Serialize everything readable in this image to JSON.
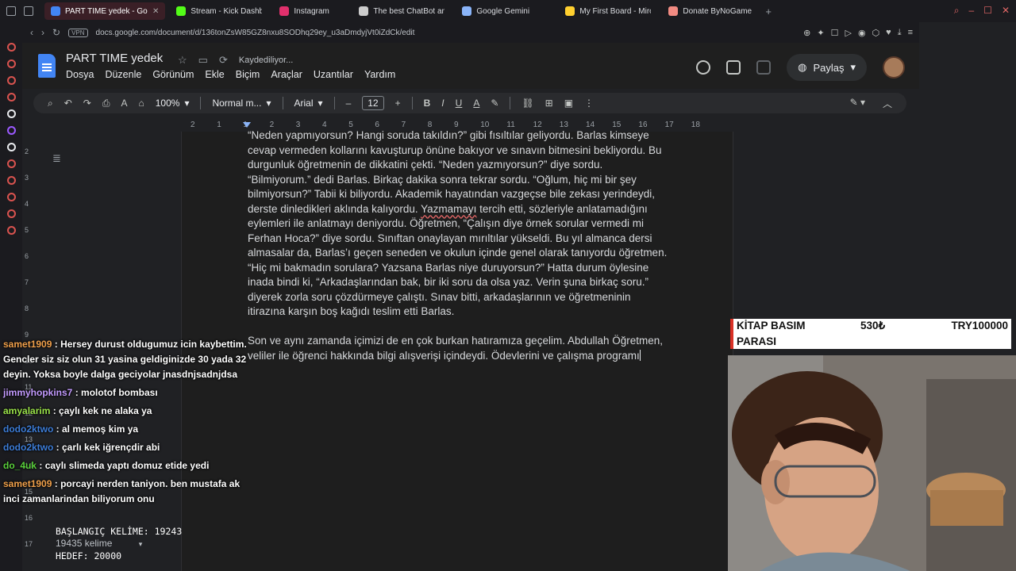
{
  "browser": {
    "tabs": [
      {
        "label": "PART TIME yedek - Goog",
        "color": "#4285f4",
        "active": true
      },
      {
        "label": "Stream - Kick Dashbo",
        "color": "#53fc18"
      },
      {
        "label": "Instagram",
        "color": "#e1306c"
      },
      {
        "label": "The best ChatBot and W",
        "color": "#cccccc"
      },
      {
        "label": "Google Gemini",
        "color": "#8ab4f8"
      },
      {
        "label": "My First Board - Miro",
        "color": "#ffd02f"
      },
      {
        "label": "Donate ByNoGame - Geli",
        "color": "#f28b82"
      }
    ],
    "vpn": "VPN",
    "url": "docs.google.com/document/d/136tonZsW85GZ8nxu8SODhq29ey_u3aDmdyjVt0iZdCk/edit"
  },
  "docs": {
    "title": "PART TIME  yedek",
    "status": "Kaydediliyor...",
    "menu": [
      "Dosya",
      "Düzenle",
      "Görünüm",
      "Ekle",
      "Biçim",
      "Araçlar",
      "Uzantılar",
      "Yardım"
    ],
    "share_label": "Paylaş",
    "toolbar": {
      "zoom": "100%",
      "style": "Normal m...",
      "font": "Arial",
      "font_size": "12"
    },
    "ruler_ticks": [
      "2",
      "1",
      "1",
      "2",
      "3",
      "4",
      "5",
      "6",
      "7",
      "8",
      "9",
      "10",
      "11",
      "12",
      "13",
      "14",
      "15",
      "16",
      "17",
      "18"
    ],
    "vruler_ticks": [
      "2",
      "3",
      "4",
      "5",
      "6",
      "7",
      "8",
      "9",
      "10",
      "11",
      "12",
      "13",
      "14",
      "15",
      "16",
      "17"
    ],
    "paragraph1_a": "“Neden yapmıyorsun? Hangi soruda takıldın?” gibi fısıltılar geliyordu. Barlas kimseye cevap vermeden kollarını kavuşturup önüne bakıyor ve sınavın bitmesini bekliyordu. Bu durgunluk öğretmenin de dikkatini çekti. “Neden yazmıyorsun?” diye sordu. “Bilmiyorum.” dedi Barlas. Birkaç dakika sonra tekrar sordu. “Oğlum, hiç mi bir şey bilmiyorsun?” Tabii ki biliyordu. Akademik hayatından vazgeçse bile zekası yerindeydi, derste dinledikleri aklında kalıyordu. ",
    "paragraph1_misspelled": "Yazmamayı",
    "paragraph1_b": " tercih etti, sözleriyle anlatamadığını eylemleri ile anlatmayı deniyordu. Öğretmen, “Çalışın diye örnek sorular vermedi mi Ferhan Hoca?” diye sordu. Sınıftan onaylayan mırıltılar yükseldi. Bu yıl almanca dersi almasalar da, Barlas’ı geçen seneden ve okulun içinde genel olarak tanıyordu öğretmen. “Hiç mi bakmadın sorulara? Yazsana Barlas niye duruyorsun?” Hatta durum öylesine inada bindi ki, “Arkadaşlarından bak, bir iki soru da olsa yaz. Verin şuna birkaç soru.” diyerek zorla soru çözdürmeye çalıştı. Sınav bitti, arkadaşlarının ve öğretmeninin itirazına karşın boş kağıdı teslim etti Barlas.",
    "paragraph2": "Son ve aynı zamanda içimizi de en çok burkan hatıramıza geçelim. Abdullah Öğretmen, veliler ile öğrenci hakkında bilgi alışverişi içindeydi. Ödevlerini ve çalışma programı"
  },
  "chat": [
    {
      "user": "samet1909",
      "color": "#f0a04b",
      "text": "Hersey durust oldugumuz icin kaybettim. Gencler siz siz olun 31 yasina geldiginizde 30 yada 32 deyin. Yoksa boyle dalga geciyolar jnasdnjsadnjdsa"
    },
    {
      "user": "jimmyhopkins7",
      "color": "#c39bff",
      "text": "molotof bombası"
    },
    {
      "user": "amyalarim",
      "color": "#9be34a",
      "text": "çaylı kek ne alaka ya"
    },
    {
      "user": "dodo2ktwo",
      "color": "#3d7dd8",
      "text": "al memoş kim ya"
    },
    {
      "user": "dodo2ktwo",
      "color": "#3d7dd8",
      "text": "çarlı kek iğrençdir abi"
    },
    {
      "user": "do_4uk",
      "color": "#5ad13c",
      "text": "caylı slimeda yaptı domuz etide yedi"
    },
    {
      "user": "samet1909",
      "color": "#f0a04b",
      "text": "porcayi nerden taniyon. ben mustafa ak inci zamanlarindan biliyorum onu"
    }
  ],
  "word_goal": {
    "start": "BAŞLANGIÇ KELİME: 19243",
    "current": "19435 kelime",
    "target": "HEDEF: 20000"
  },
  "overlay": {
    "label_line1": "KİTAP BASIM",
    "label_line2": "PARASI",
    "current": "530₺",
    "goal": "TRY100000"
  }
}
